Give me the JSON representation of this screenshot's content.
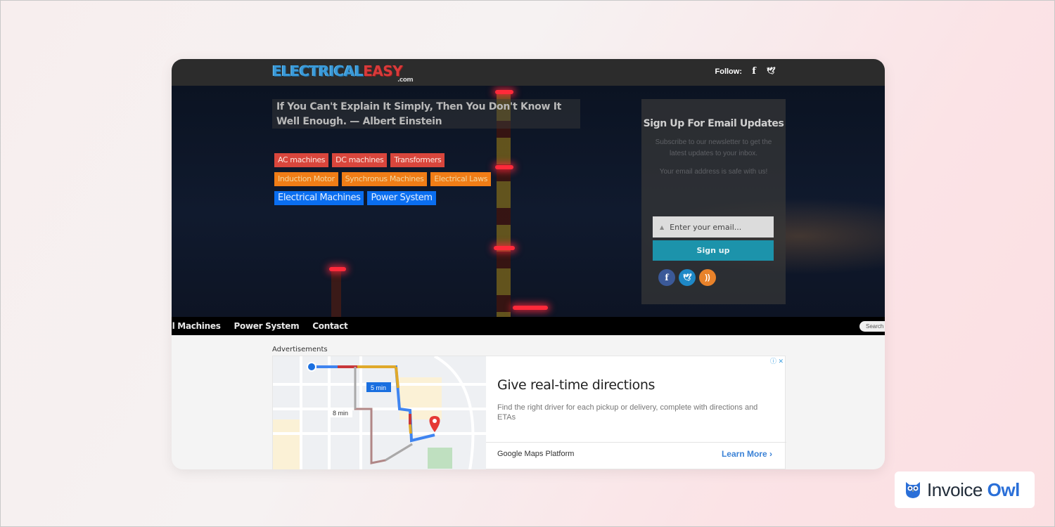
{
  "header": {
    "logo_part1": "ELECTRICAL",
    "logo_part2": "EASY",
    "logo_suffix": ".com",
    "follow_label": "Follow:",
    "follow_icons": [
      "facebook-icon",
      "twitter-icon"
    ]
  },
  "hero": {
    "quote": "If You Can't Explain It Simply, Then You Don't Know It Well Enough. — Albert Einstein",
    "tag_rows": [
      [
        {
          "label": "AC machines",
          "color": "red"
        },
        {
          "label": "DC machines",
          "color": "red"
        },
        {
          "label": "Transformers",
          "color": "red"
        }
      ],
      [
        {
          "label": "Induction Motor",
          "color": "orange"
        },
        {
          "label": "Synchronus Machines",
          "color": "orange"
        },
        {
          "label": "Electrical Laws",
          "color": "orange"
        }
      ],
      [
        {
          "label": "Electrical Machines",
          "color": "blue"
        },
        {
          "label": "Power System",
          "color": "blue"
        }
      ]
    ]
  },
  "signup": {
    "title": "Sign Up For Email Updates",
    "description": "Subscribe to our newsletter to get the latest updates to your inbox.",
    "safe_note": "Your email address is safe with us!",
    "email_placeholder": "Enter your email...",
    "button_label": "Sign up",
    "social": [
      {
        "name": "facebook",
        "glyph": "f",
        "color": "#3b5998"
      },
      {
        "name": "twitter",
        "glyph": "🐦",
        "color": "#1e88c7"
      },
      {
        "name": "rss",
        "glyph": "◉",
        "color": "#e8822a"
      }
    ]
  },
  "nav": {
    "items": [
      "cal Machines",
      "Power System",
      "Contact"
    ],
    "search_placeholder": "Search"
  },
  "ad": {
    "label": "Advertisements",
    "map_label_fast": "5 min",
    "map_label_slow": "8 min",
    "title": "Give real-time directions",
    "description": "Find the right driver for each pickup or delivery, complete with directions and ETAs",
    "brand": "Google Maps Platform",
    "cta": "Learn More",
    "info_glyph": "ⓘ ✕"
  },
  "watermark": {
    "brand_part1": "Invoice",
    "brand_part2": "Owl"
  },
  "colors": {
    "tag_red": "#d9463c",
    "tag_orange": "#f07d16",
    "tag_blue": "#0a6ef0",
    "signup_button": "#1c93ab",
    "link_blue": "#3b82d6"
  }
}
